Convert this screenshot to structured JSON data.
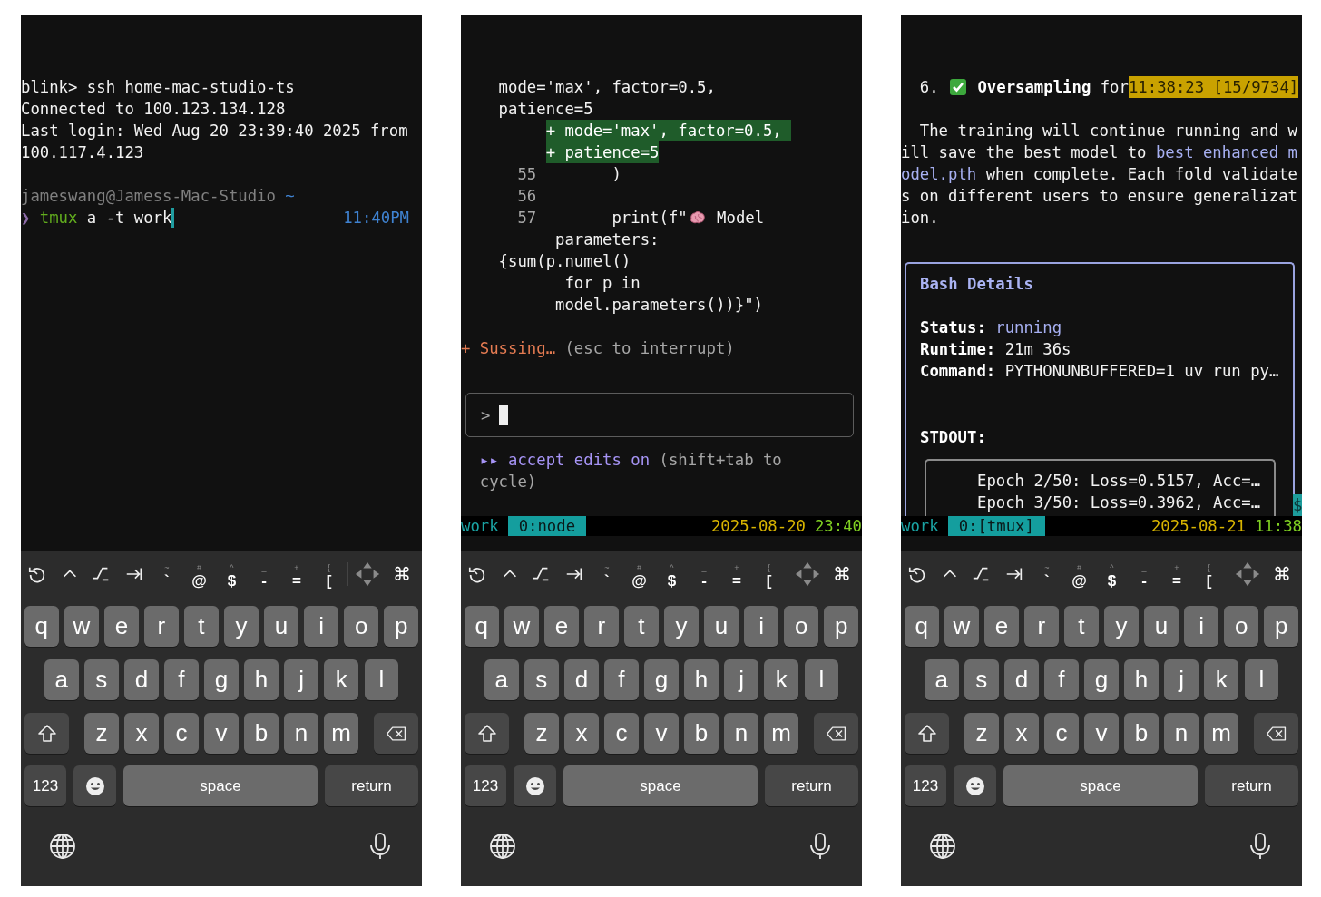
{
  "phones": [
    {
      "terminal": {
        "blocks": [
          {
            "kind": "lines",
            "lines": [
              [
                {
                  "text": "blink> ssh home-mac-studio-ts",
                  "kind": "plain"
                }
              ],
              [
                {
                  "text": "Connected to 100.123.134.128",
                  "kind": "plain"
                }
              ],
              [
                {
                  "text": "Last login: Wed Aug 20 23:39:40 2025 from",
                  "kind": "plain"
                }
              ],
              [
                {
                  "text": "100.117.4.123",
                  "kind": "plain"
                }
              ]
            ]
          },
          {
            "kind": "prompt",
            "path_line": [
              {
                "text": "jameswang@Jamess-Mac-Studio",
                "kind": "dim"
              },
              {
                "text": " ~",
                "kind": "blue"
              }
            ],
            "symbol": "❯",
            "command": [
              {
                "text": " tmux",
                "kind": "green"
              },
              {
                "text": " a -t work",
                "kind": "plain"
              }
            ],
            "time": "11:40PM"
          }
        ]
      },
      "keyboard": {
        "toolbar": [
          {
            "main": "`",
            "shifted": "~"
          },
          {
            "main": "@",
            "shifted": "#"
          },
          {
            "main": "$",
            "shifted": "^"
          },
          {
            "main": "-",
            "shifted": "_"
          },
          {
            "main": "=",
            "shifted": "+"
          },
          {
            "main": "[",
            "shifted": "{"
          }
        ],
        "command_key": "⌘",
        "rows": [
          [
            "q",
            "w",
            "e",
            "r",
            "t",
            "y",
            "u",
            "i",
            "o",
            "p"
          ],
          [
            "a",
            "s",
            "d",
            "f",
            "g",
            "h",
            "j",
            "k",
            "l"
          ],
          [
            "z",
            "x",
            "c",
            "v",
            "b",
            "n",
            "m"
          ]
        ],
        "numbers_key": "123",
        "space_key": "space",
        "return_key": "return"
      }
    },
    {
      "terminal": {
        "blocks": [
          {
            "kind": "lines",
            "lines": [
              [
                {
                  "text": "    mode='max', factor=0.5,",
                  "kind": "plain"
                }
              ],
              [
                {
                  "text": "    patience=5",
                  "kind": "plain"
                }
              ],
              [
                {
                  "text": "+ mode='max', factor=0.5, ",
                  "kind": "added"
                }
              ],
              [
                {
                  "text": "+ patience=5",
                  "kind": "added"
                }
              ],
              [
                {
                  "text": "      55",
                  "kind": "lineno"
                },
                {
                  "text": "        )",
                  "kind": "plain"
                }
              ],
              [
                {
                  "text": "      56",
                  "kind": "lineno"
                }
              ],
              [
                {
                  "text": "      57",
                  "kind": "lineno"
                },
                {
                  "text": "        print(f\"",
                  "kind": "plain"
                },
                {
                  "kind": "brain"
                },
                {
                  "text": " Model",
                  "kind": "plain"
                }
              ],
              [
                {
                  "text": "          parameters:",
                  "kind": "plain"
                }
              ],
              [
                {
                  "text": "    {sum(p.numel()",
                  "kind": "plain"
                }
              ],
              [
                {
                  "text": "           for p in",
                  "kind": "plain"
                }
              ],
              [
                {
                  "text": "          model.parameters())}\")",
                  "kind": "plain"
                }
              ]
            ]
          },
          {
            "kind": "lines",
            "lines": [
              [
                {
                  "text": "+",
                  "kind": "orange"
                },
                {
                  "text": " Sussing…",
                  "kind": "orange"
                },
                {
                  "text": " (esc to interrupt)",
                  "kind": "grey"
                }
              ]
            ]
          },
          {
            "kind": "input_box",
            "symbol": ">"
          },
          {
            "kind": "lines",
            "lines": [
              [
                {
                  "text": "  ▸▸ accept edits on",
                  "kind": "mode"
                },
                {
                  "text": " (shift+tab to",
                  "kind": "grey"
                }
              ],
              [
                {
                  "text": "  cycle)",
                  "kind": "grey"
                }
              ]
            ]
          }
        ],
        "status_bar": {
          "session": "work",
          "window": "0:node",
          "date": "2025-08-20",
          "time": "23:40"
        }
      },
      "keyboard": {
        "toolbar": [
          {
            "main": "`",
            "shifted": "~"
          },
          {
            "main": "@",
            "shifted": "#"
          },
          {
            "main": "$",
            "shifted": "^"
          },
          {
            "main": "-",
            "shifted": "_"
          },
          {
            "main": "=",
            "shifted": "+"
          },
          {
            "main": "[",
            "shifted": "{"
          }
        ],
        "command_key": "⌘",
        "rows": [
          [
            "q",
            "w",
            "e",
            "r",
            "t",
            "y",
            "u",
            "i",
            "o",
            "p"
          ],
          [
            "a",
            "s",
            "d",
            "f",
            "g",
            "h",
            "j",
            "k",
            "l"
          ],
          [
            "z",
            "x",
            "c",
            "v",
            "b",
            "n",
            "m"
          ]
        ],
        "numbers_key": "123",
        "space_key": "space",
        "return_key": "return"
      }
    },
    {
      "terminal": {
        "blocks": [
          {
            "kind": "lines",
            "lines": [
              [
                {
                  "text": "  6. ",
                  "kind": "plain"
                },
                {
                  "kind": "check"
                },
                {
                  "text": " Oversampling",
                  "kind": "bold"
                },
                {
                  "text": " for",
                  "kind": "plain"
                },
                {
                  "text": "11:38:23 [15/9734]",
                  "kind": "highlight"
                }
              ]
            ]
          },
          {
            "kind": "lines",
            "lines": [
              [
                {
                  "text": "  The training will continue running and w",
                  "kind": "plain"
                }
              ],
              [
                {
                  "text": "ill save the best model to ",
                  "kind": "plain"
                },
                {
                  "text": "best_enhanced_m",
                  "kind": "link"
                }
              ],
              [
                {
                  "text": "odel.pth",
                  "kind": "link"
                },
                {
                  "text": " when complete. Each fold validate",
                  "kind": "plain"
                }
              ],
              [
                {
                  "text": "s on different users to ensure generalizat",
                  "kind": "plain"
                }
              ],
              [
                {
                  "text": "ion.",
                  "kind": "plain"
                }
              ]
            ]
          },
          {
            "kind": "details",
            "title": "Bash Details",
            "fields": [
              {
                "label": "Status:",
                "value": "running",
                "highlighted": true
              },
              {
                "label": "Runtime:",
                "value": "21m 36s",
                "highlighted": false
              },
              {
                "label": "Command:",
                "value": "PYTHONUNBUFFERED=1 uv run py…",
                "highlighted": false
              }
            ],
            "section_label": "STDOUT:",
            "output_lines": [
              "Epoch 2/50: Loss=0.5157, Acc=…",
              "Epoch 3/50: Loss=0.3962, Acc=…"
            ]
          }
        ],
        "corner_marker": "$",
        "status_bar": {
          "session": "work",
          "window": "0:[tmux]",
          "date": "2025-08-21",
          "time": "11:38"
        }
      },
      "keyboard": {
        "toolbar": [
          {
            "main": "`",
            "shifted": "~"
          },
          {
            "main": "@",
            "shifted": "#"
          },
          {
            "main": "$",
            "shifted": "^"
          },
          {
            "main": "-",
            "shifted": "_"
          },
          {
            "main": "=",
            "shifted": "+"
          },
          {
            "main": "[",
            "shifted": "{"
          }
        ],
        "command_key": "⌘",
        "rows": [
          [
            "q",
            "w",
            "e",
            "r",
            "t",
            "y",
            "u",
            "i",
            "o",
            "p"
          ],
          [
            "a",
            "s",
            "d",
            "f",
            "g",
            "h",
            "j",
            "k",
            "l"
          ],
          [
            "z",
            "x",
            "c",
            "v",
            "b",
            "n",
            "m"
          ]
        ],
        "numbers_key": "123",
        "space_key": "space",
        "return_key": "return"
      }
    }
  ]
}
